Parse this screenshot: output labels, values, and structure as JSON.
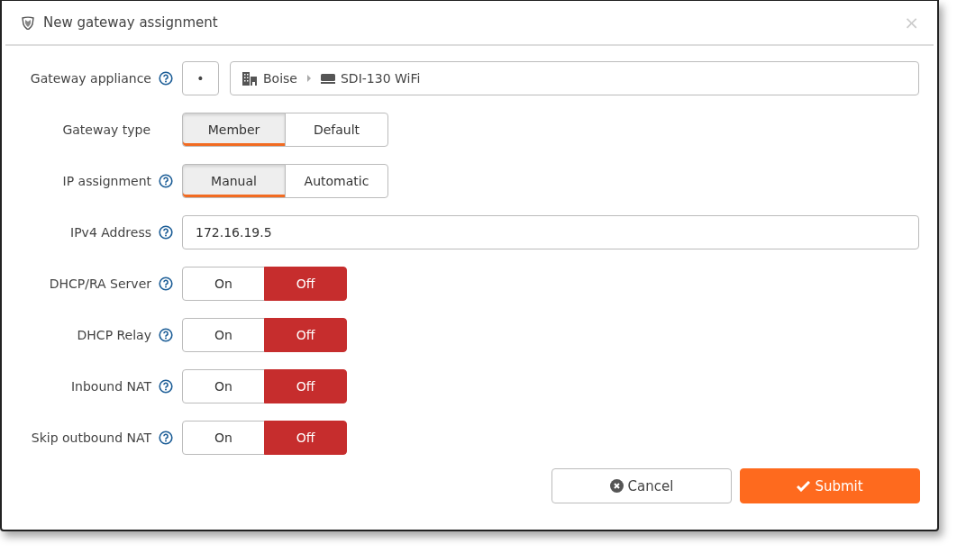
{
  "dialog": {
    "title": "New gateway assignment",
    "close": "×"
  },
  "fields": [
    {
      "kind": "appliance",
      "label": "Gateway appliance",
      "help": true,
      "picker": "•",
      "site": "Boise",
      "device": "SDI-130 WiFi"
    },
    {
      "kind": "segmented",
      "label": "Gateway type",
      "help": false,
      "options": [
        {
          "label": "Member",
          "selected": true
        },
        {
          "label": "Default",
          "selected": false
        }
      ]
    },
    {
      "kind": "segmented",
      "label": "IP assignment",
      "help": true,
      "options": [
        {
          "label": "Manual",
          "selected": true
        },
        {
          "label": "Automatic",
          "selected": false
        }
      ]
    },
    {
      "kind": "text",
      "label": "IPv4 Address",
      "help": true,
      "value": "172.16.19.5"
    },
    {
      "kind": "toggle",
      "label": "DHCP/RA Server",
      "help": true,
      "options": [
        {
          "label": "On",
          "selected": false
        },
        {
          "label": "Off",
          "selected": true
        }
      ]
    },
    {
      "kind": "toggle",
      "label": "DHCP Relay",
      "help": true,
      "options": [
        {
          "label": "On",
          "selected": false
        },
        {
          "label": "Off",
          "selected": true
        }
      ]
    },
    {
      "kind": "toggle",
      "label": "Inbound NAT",
      "help": true,
      "options": [
        {
          "label": "On",
          "selected": false
        },
        {
          "label": "Off",
          "selected": true
        }
      ]
    },
    {
      "kind": "toggle",
      "label": "Skip outbound NAT",
      "help": true,
      "options": [
        {
          "label": "On",
          "selected": false
        },
        {
          "label": "Off",
          "selected": true
        }
      ]
    }
  ],
  "buttons": [
    {
      "kind": "cancel",
      "label": "Cancel"
    },
    {
      "kind": "submit",
      "label": "Submit"
    }
  ]
}
